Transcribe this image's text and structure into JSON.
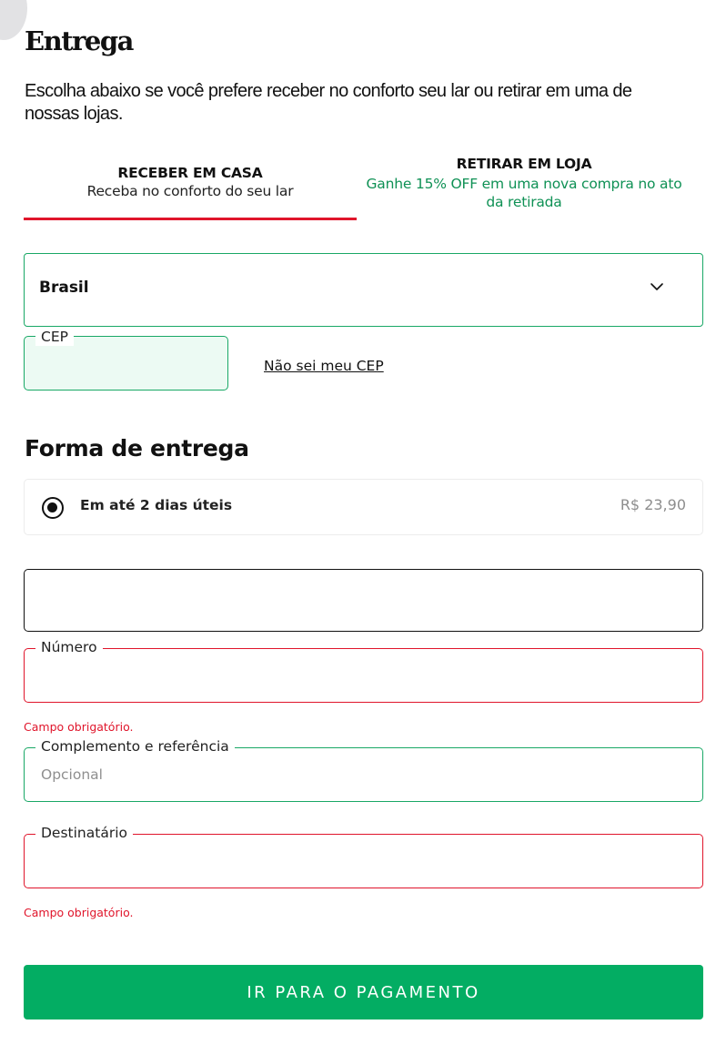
{
  "page": {
    "title": "Entrega",
    "intro": "Escolha abaixo se você prefere receber no conforto seu lar ou retirar em uma de nossas lojas."
  },
  "tabs": [
    {
      "title": "RECEBER EM CASA",
      "subtitle": "Receba no conforto do seu lar",
      "active": true
    },
    {
      "title": "RETIRAR EM LOJA",
      "subtitle": "Ganhe 15% OFF em uma nova compra no ato da retirada",
      "active": false
    }
  ],
  "country": {
    "value": "Brasil",
    "icon": "chevron-down-icon"
  },
  "cep": {
    "label": "CEP",
    "value": "",
    "help_link": "Não sei meu CEP"
  },
  "shipping": {
    "title": "Forma de entrega",
    "option": {
      "label": "Em até 2 dias úteis",
      "price": "R$ 23,90",
      "selected": true
    }
  },
  "address": {
    "street": {
      "value": ""
    },
    "number": {
      "label": "Número",
      "value": "",
      "error": "Campo obrigatório."
    },
    "complement": {
      "label": "Complemento e referência",
      "placeholder": "Opcional",
      "value": ""
    },
    "recipient": {
      "label": "Destinatário",
      "value": "",
      "error": "Campo obrigatório."
    }
  },
  "submit": {
    "label": "IR PARA O PAGAMENTO"
  },
  "colors": {
    "accent_green": "#03ad63",
    "field_border_green": "#19a866",
    "error_red": "#e0152b",
    "tab_active_underline": "#e0152b",
    "promo_green": "#0f9155"
  }
}
